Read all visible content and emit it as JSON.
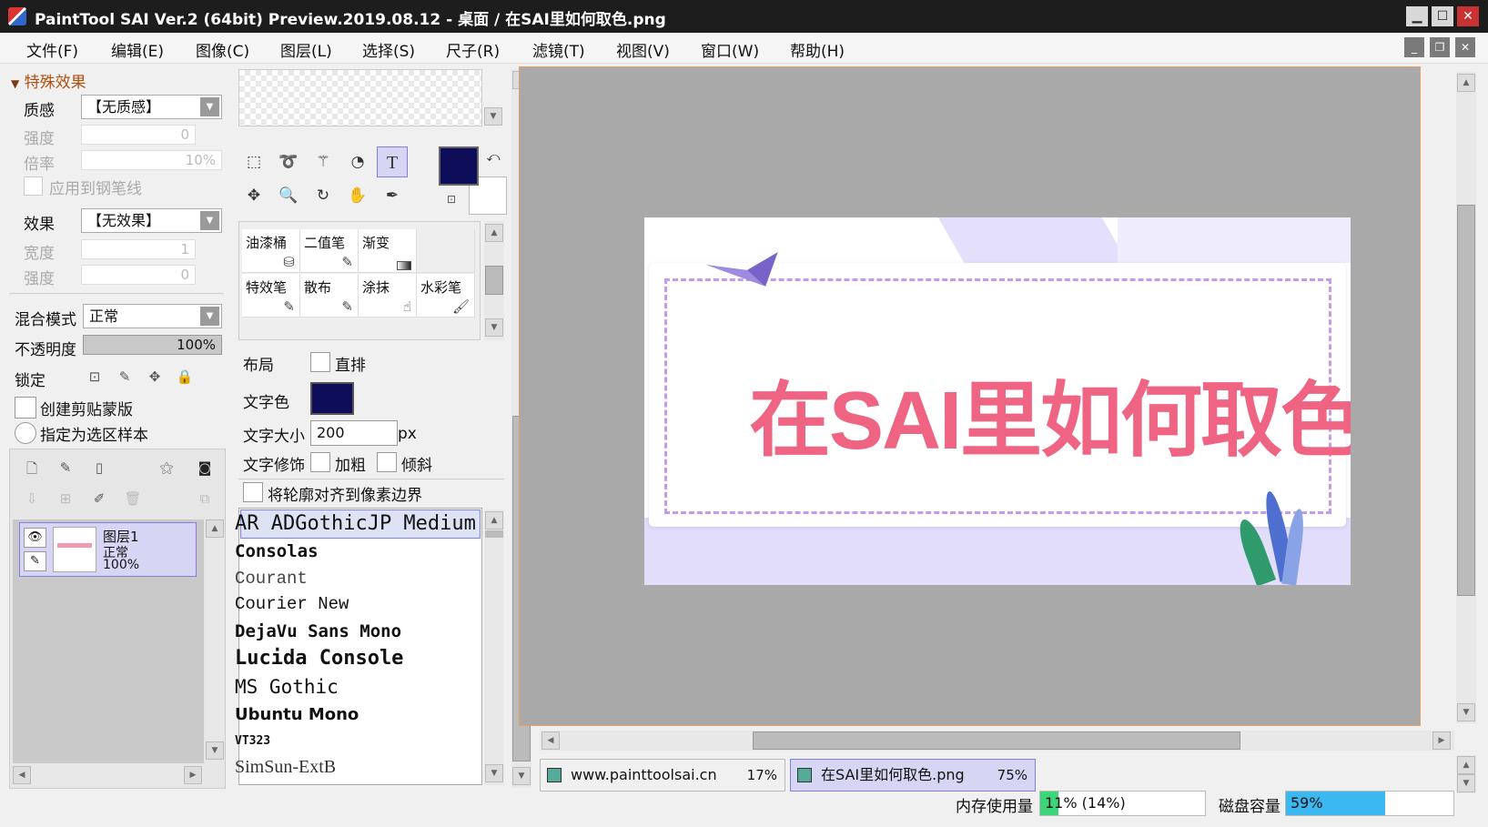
{
  "window": {
    "title": "PaintTool SAI Ver.2 (64bit) Preview.2019.08.12 - 桌面 / 在SAI里如何取色.png"
  },
  "menu": [
    "文件(F)",
    "编辑(E)",
    "图像(C)",
    "图层(L)",
    "选择(S)",
    "尺子(R)",
    "滤镜(T)",
    "视图(V)",
    "窗口(W)",
    "帮助(H)"
  ],
  "left_panel": {
    "section_title": "特殊效果",
    "texture_label": "质感",
    "texture_value": "【无质感】",
    "strength_label": "强度",
    "strength_value": "0",
    "scale_label": "倍率",
    "scale_value": "10%",
    "apply_pen_label": "应用到钢笔线",
    "effect_label": "效果",
    "effect_value": "【无效果】",
    "width_label": "宽度",
    "width_value": "1",
    "effect_strength_label": "强度",
    "effect_strength_value": "0",
    "blend_label": "混合模式",
    "blend_value": "正常",
    "opacity_label": "不透明度",
    "opacity_value": "100%",
    "lock_label": "锁定",
    "clip_label": "创建剪贴蒙版",
    "sample_label": "指定为选区样本"
  },
  "layer": {
    "name": "图层1",
    "mode": "正常",
    "opacity": "100%"
  },
  "brushes": [
    {
      "label": "油漆桶"
    },
    {
      "label": "二值笔"
    },
    {
      "label": "渐变"
    },
    {
      "label": ""
    },
    {
      "label": "特效笔"
    },
    {
      "label": "散布"
    },
    {
      "label": "涂抹"
    },
    {
      "label": "水彩笔"
    }
  ],
  "text_tool": {
    "layout_label": "布局",
    "vertical_label": "直排",
    "color_label": "文字色",
    "text_color": "#0d0d5a",
    "size_label": "文字大小",
    "size_value": "200",
    "size_unit": "px",
    "decoration_label": "文字修饰",
    "bold_label": "加粗",
    "italic_label": "倾斜",
    "align_label": "将轮廓对齐到像素边界"
  },
  "fonts": [
    "AR ADGothicJP Medium",
    "Consolas",
    "Courant",
    "Courier New",
    "DejaVu Sans Mono",
    "Lucida Console",
    "MS Gothic",
    "Ubuntu Mono",
    "VT323",
    "SimSun-ExtB"
  ],
  "canvas": {
    "text": "在SAI里如何取色"
  },
  "tabs": [
    {
      "name": "www.painttoolsai.cn",
      "zoom": "17%"
    },
    {
      "name": "在SAI里如何取色.png",
      "zoom": "75%"
    }
  ],
  "status": {
    "memory_label": "内存使用量",
    "memory_value": "11% (14%)",
    "memory_fraction": 0.11,
    "disk_label": "磁盘容量",
    "disk_value": "59%",
    "disk_fraction": 0.59
  }
}
